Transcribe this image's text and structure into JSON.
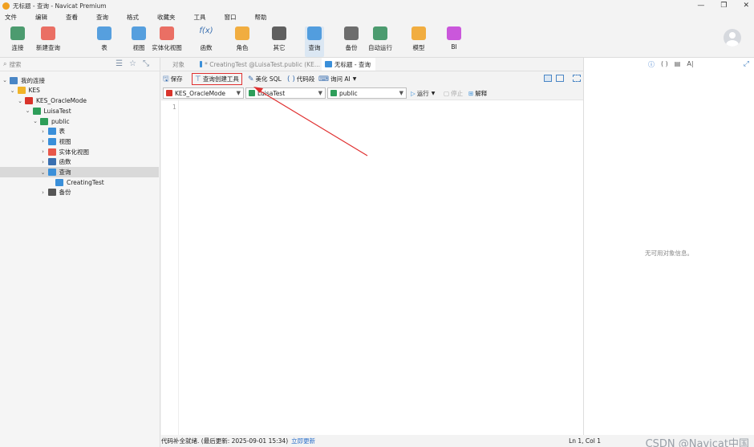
{
  "window": {
    "title": "无标题 - 查询 - Navicat Premium",
    "controls": [
      "—",
      "❐",
      "✕"
    ]
  },
  "menu": [
    "文件",
    "编辑",
    "查看",
    "查询",
    "格式",
    "收藏夹",
    "工具",
    "窗口",
    "帮助"
  ],
  "toolbar": [
    {
      "label": "连接",
      "icon": "plug-icon",
      "color": "#2e8b57"
    },
    {
      "label": "新建查询",
      "icon": "new-query-icon",
      "color": "#e8574a"
    },
    {
      "label": "表",
      "icon": "table-icon",
      "color": "#3a8fd9"
    },
    {
      "label": "视图",
      "icon": "glasses-icon",
      "color": "#3a8fd9"
    },
    {
      "label": "实体化视图",
      "icon": "materialized-view-icon",
      "color": "#e8574a"
    },
    {
      "label": "函数",
      "icon": "function-icon",
      "color": "#3a6fb0",
      "glyph": "f(x)"
    },
    {
      "label": "角色",
      "icon": "user-icon",
      "color": "#f0a020"
    },
    {
      "label": "其它",
      "icon": "tools-icon",
      "color": "#444"
    },
    {
      "label": "查询",
      "icon": "query-icon",
      "color": "#3a8fd9"
    },
    {
      "label": "备份",
      "icon": "backup-icon",
      "color": "#555"
    },
    {
      "label": "自动运行",
      "icon": "robot-icon",
      "color": "#2e8b57"
    },
    {
      "label": "模型",
      "icon": "model-icon",
      "color": "#f0a020"
    },
    {
      "label": "BI",
      "icon": "bi-icon",
      "color": "#c23bd6"
    }
  ],
  "sidebar": {
    "search_placeholder": "搜索",
    "tree": [
      {
        "label": "我的连接",
        "depth": 0,
        "chevron": "open",
        "icon": "connections-icon",
        "color": "#4a86c5"
      },
      {
        "label": "KES",
        "depth": 1,
        "chevron": "open",
        "icon": "folder-icon",
        "color": "#f0b429"
      },
      {
        "label": "KES_OracleMode",
        "depth": 2,
        "chevron": "open",
        "icon": "kes-icon",
        "color": "#d9342b"
      },
      {
        "label": "LuisaTest",
        "depth": 3,
        "chevron": "open",
        "icon": "database-icon",
        "color": "#2e9e5a"
      },
      {
        "label": "public",
        "depth": 4,
        "chevron": "open",
        "icon": "schema-icon",
        "color": "#2e9e5a"
      },
      {
        "label": "表",
        "depth": 5,
        "chevron": "closed",
        "icon": "table-icon",
        "color": "#3a8fd9"
      },
      {
        "label": "视图",
        "depth": 5,
        "chevron": "closed",
        "icon": "view-icon",
        "color": "#3a8fd9"
      },
      {
        "label": "实体化视图",
        "depth": 5,
        "chevron": "closed",
        "icon": "materialized-view-icon",
        "color": "#e8574a"
      },
      {
        "label": "函数",
        "depth": 5,
        "chevron": "closed",
        "icon": "function-icon",
        "color": "#3a6fb0"
      },
      {
        "label": "查询",
        "depth": 5,
        "chevron": "open",
        "icon": "query-icon",
        "color": "#3a8fd9",
        "selected": true
      },
      {
        "label": "CreatingTest",
        "depth": 6,
        "chevron": "none",
        "icon": "query-icon",
        "color": "#3a8fd9"
      },
      {
        "label": "备份",
        "depth": 5,
        "chevron": "closed",
        "icon": "backup-icon",
        "color": "#555"
      }
    ]
  },
  "tabs": [
    {
      "label": "对象",
      "active": false
    },
    {
      "label": "* CreatingTest @LuisaTest.public (KE...",
      "active": false
    },
    {
      "label": "无标题 - 查询",
      "active": true
    }
  ],
  "editor_toolbar": {
    "save": "保存",
    "query_builder": "查询创建工具",
    "beautify": "美化 SQL",
    "snippet": "代码段",
    "ask_ai": "询问 AI"
  },
  "connection": {
    "connection": "KES_OracleMode",
    "database": "LuisaTest",
    "schema": "public",
    "run": "运行",
    "stop": "停止",
    "explain": "解释"
  },
  "editor": {
    "line_number": "1"
  },
  "status": {
    "message": "代码补全就绪. (最后更新: 2025-09-01 15:34)",
    "update_link": "立即更新",
    "position": "Ln 1, Col 1",
    "watermark": "CSDN @Navicat中国"
  },
  "right_panel": {
    "empty": "无可用对象信息。"
  },
  "accent": "#3a8fd9",
  "annotation_color": "#e03030"
}
